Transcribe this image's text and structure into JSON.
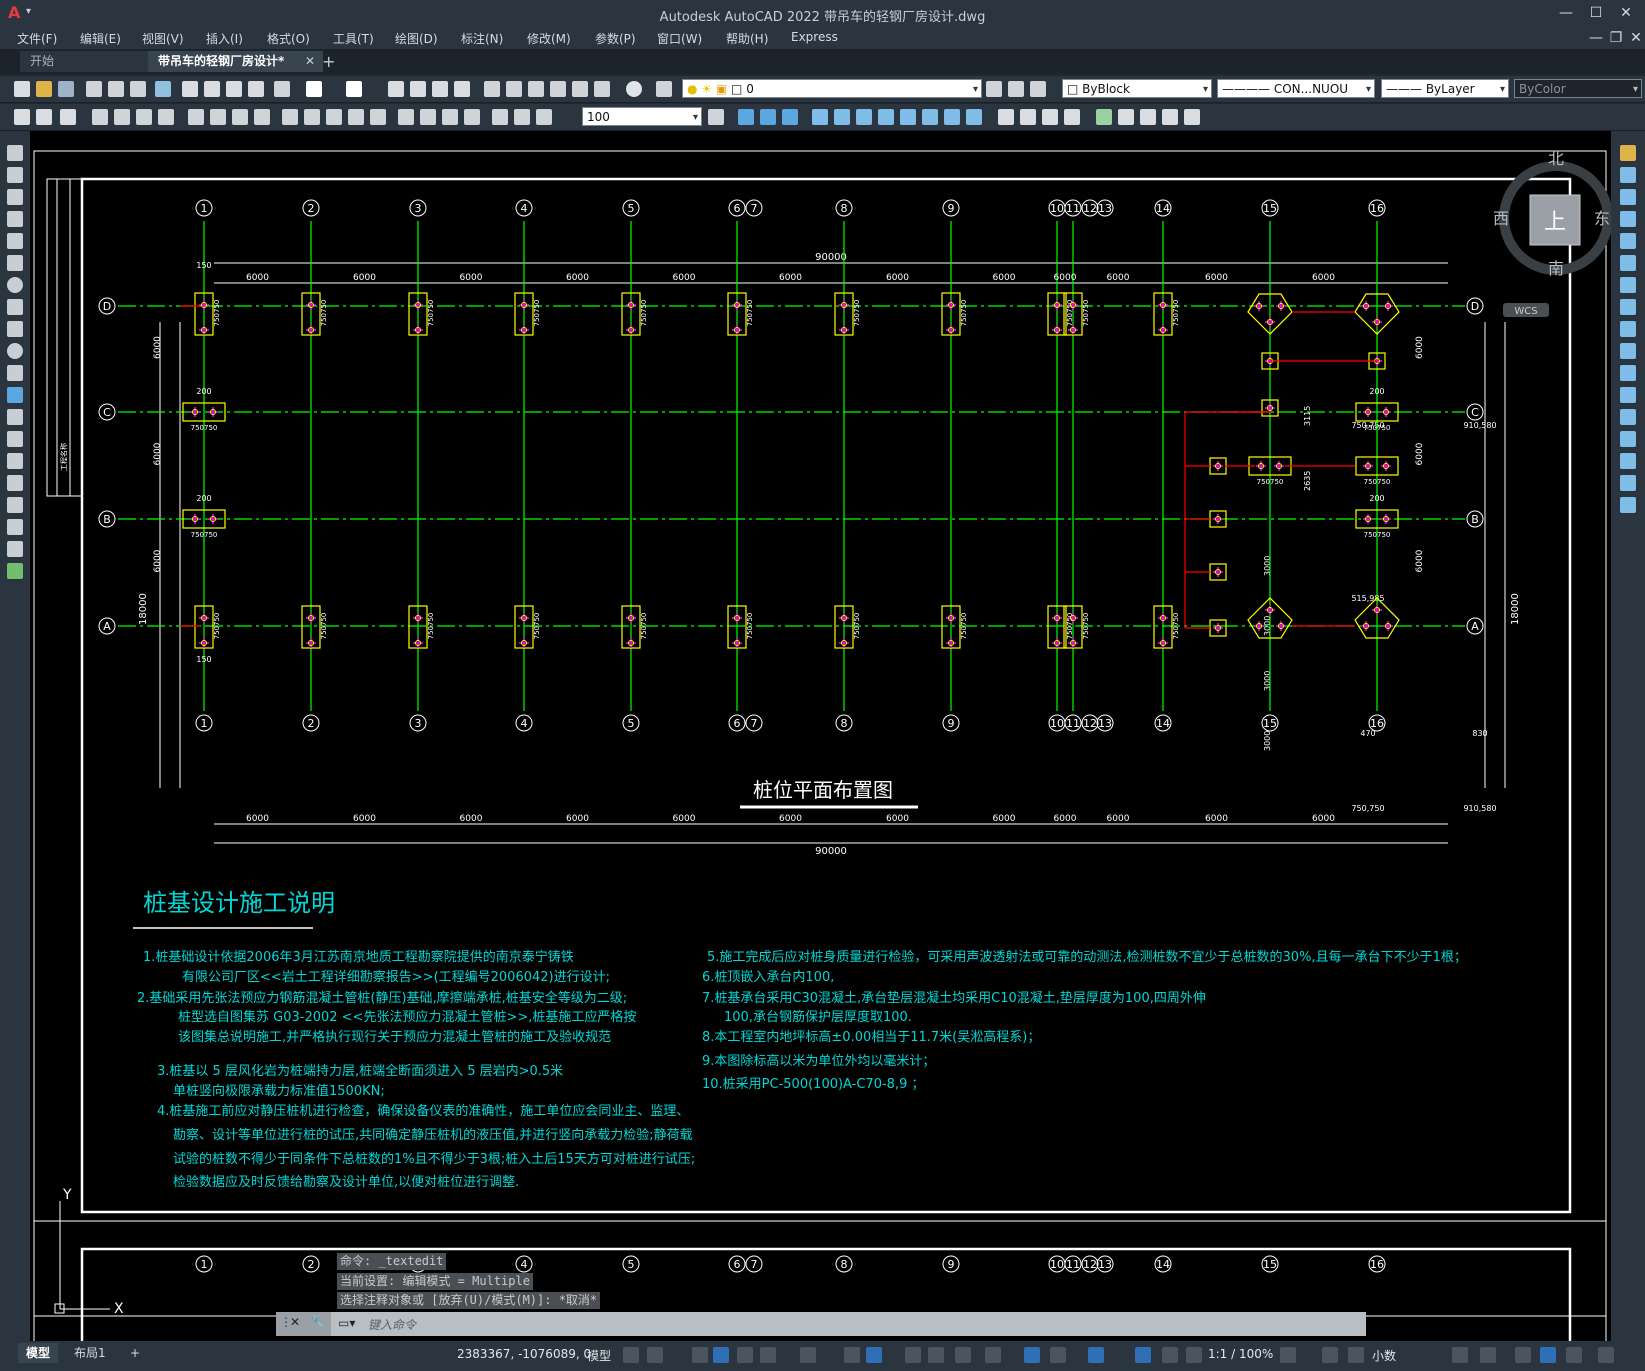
{
  "app": {
    "logo": "A",
    "title": "Autodesk AutoCAD 2022    带吊车的轻钢厂房设计.dwg",
    "window_buttons": [
      "—",
      "☐",
      "✕"
    ],
    "doc_buttons": [
      "—",
      "❐",
      "✕"
    ]
  },
  "menu": [
    "文件(F)",
    "编辑(E)",
    "视图(V)",
    "插入(I)",
    "格式(O)",
    "工具(T)",
    "绘图(D)",
    "标注(N)",
    "修改(M)",
    "参数(P)",
    "窗口(W)",
    "帮助(H)",
    "Express"
  ],
  "tabs": {
    "start": "开始",
    "active": "带吊车的轻钢厂房设计*",
    "close": "✕",
    "add": "+"
  },
  "toolbar": {
    "layer_value": "0",
    "color_value": "ByBlock",
    "linetype_value": "CON...NUOU",
    "lineweight_value": "ByLayer",
    "plotstyle_value": "ByColor",
    "dimscale_value": "100"
  },
  "viewcube": {
    "north": "北",
    "south": "南",
    "east": "东",
    "west": "西",
    "top": "上",
    "wcs": "WCS"
  },
  "drawing": {
    "grid_columns": [
      "1",
      "2",
      "3",
      "4",
      "5",
      "6",
      "7",
      "8",
      "9",
      "10",
      "11",
      "12",
      "13",
      "14",
      "15",
      "16"
    ],
    "grid_rows": [
      "D",
      "C",
      "B",
      "A"
    ],
    "bay_dim": "6000",
    "total_length": "90000",
    "total_width": "18000",
    "cap_label": "750750",
    "dim_150": "150",
    "dim_200": "200",
    "dim_3000": "3000",
    "dim_3115": "3115",
    "dim_2635": "2635",
    "dim_470": "470",
    "dim_830": "830",
    "dim_910": "910,580",
    "dim_515": "515,985",
    "dim_750b": "750,750",
    "plan_title": "桩位平面布置图",
    "notes_title": "桩基设计施工说明",
    "notes_left": [
      "1.桩基础设计依据2006年3月江苏南京地质工程勘察院提供的南京泰宁铸铁",
      "有限公司厂区<<岩土工程详细勘察报告>>(工程编号2006042)进行设计;",
      "2.基础采用先张法预应力钢筋混凝土管桩(静压)基础,摩擦端承桩,桩基安全等级为二级;",
      "桩型选自图集苏  G03-2002  <<先张法预应力混凝土管桩>>,桩基施工应严格按",
      "该图集总说明施工,并严格执行现行关于预应力混凝土管桩的施工及验收规范",
      "3.桩基以  5   层风化岩为桩端持力层,桩端全断面须进入  5   层岩内>0.5米",
      "单桩竖向极限承载力标准值1500KN;",
      "4.桩基施工前应对静压桩机进行检查，确保设备仪表的准确性，施工单位应会同业主、监理、",
      "勘察、设计等单位进行桩的试压,共同确定静压桩机的液压值,并进行竖向承载力检验;静荷载",
      "试验的桩数不得少于同条件下总桩数的1%且不得少于3根;桩入土后15天方可对桩进行试压;",
      "检验数据应及时反馈给勘察及设计单位,以便对桩位进行调整."
    ],
    "notes_right": [
      "5.施工完成后应对桩身质量进行检验，可采用声波透射法或可靠的动测法,检测桩数不宜少于总桩数的30%,且每一承台下不少于1根；",
      "6.桩顶嵌入承台内100,",
      "7.桩基承台采用C30混凝土,承台垫层混凝土均采用C10混凝土,垫层厚度为100,四周外伸",
      "100,承台钢筋保护层厚度取100.",
      "8.本工程室内地坪标高±0.00相当于11.7米(吴淞高程系)；",
      "9.本图除标高以米为单位外均以毫米计；",
      "10.桩采用PC-500(100)A-C70-8,9    ；"
    ],
    "title_block_text": "工程名称",
    "axis_y": "Y",
    "axis_x": "X"
  },
  "command": {
    "history": [
      "命令: _textedit",
      "当前设置: 编辑模式 = Multiple",
      "选择注释对象或 [放弃(U)/模式(M)]: *取消*"
    ],
    "placeholder": "键入命令"
  },
  "layout_tabs": [
    "模型",
    "布局1",
    "+"
  ],
  "status": {
    "coords": "2383367, -1076089, 0",
    "space": "模型",
    "scale": "1:1 / 100%",
    "units": "小数"
  },
  "colors": {
    "grid_line": "#00ff00",
    "pile_cap": "#ffff00",
    "tie_beam": "#ff0000",
    "notes": "#00d7d7",
    "dims": "#ffffff",
    "pile_cross": "#ff00ff"
  }
}
